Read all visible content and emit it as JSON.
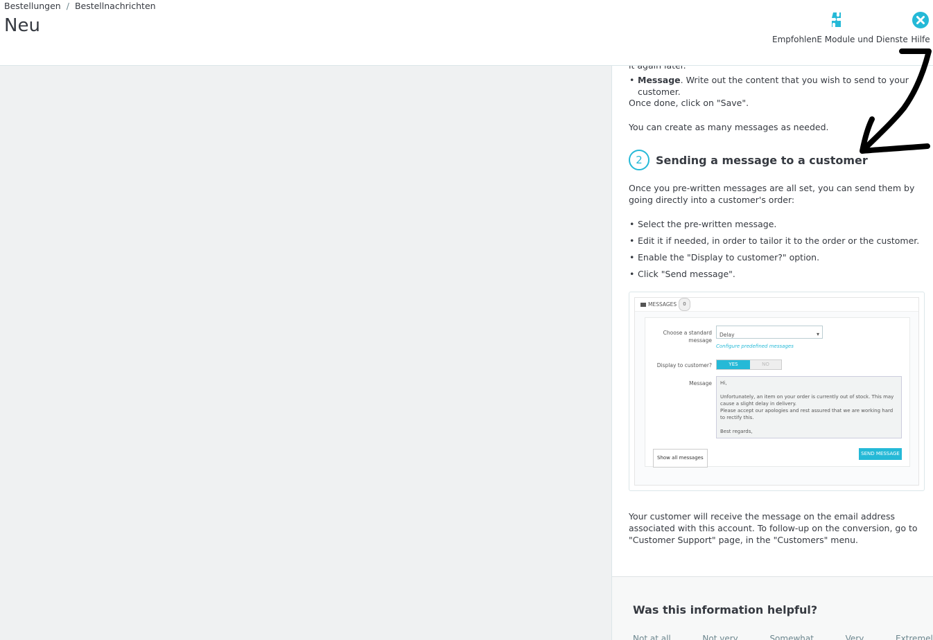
{
  "breadcrumb": {
    "items": [
      "Bestellungen",
      "Bestellnachrichten"
    ],
    "separator": "/"
  },
  "page": {
    "title": "Neu"
  },
  "toolbar": {
    "modules_label": "EmpfohlenE Module und Dienste",
    "modules_icon": "puzzle-icon",
    "help_label": "Hilfe",
    "help_icon": "close-circle-icon"
  },
  "help": {
    "cut_text": "it again later.",
    "list1": [
      {
        "bold": "Message",
        "text": ". Write out the content that you wish to send to your customer."
      }
    ],
    "save_text": "Once done, click on \"Save\".",
    "many_text": "You can create as many messages as needed.",
    "step_number": "2",
    "step_title": "Sending a message to a customer",
    "intro": "Once you pre-written messages are all set, you can send them by going directly into a customer's order:",
    "list2": [
      "Select the pre-written message.",
      "Edit it if needed, in order to tailor it to the order or the customer.",
      "Enable the \"Display to customer?\" option.",
      "Click \"Send message\"."
    ],
    "final": "Your customer will receive the message on the email address associated with this account. To follow-up on the conversion, go to \"Customer Support\" page, in the \"Customers\" menu.",
    "feedback_title": "Was this information helpful?",
    "feedback_options": [
      "Not at all",
      "Not very",
      "Somewhat",
      "Very",
      "Extremely"
    ]
  },
  "screenshot": {
    "header": "MESSAGES",
    "badge": "0",
    "choose_label": "Choose a standard message",
    "select_value": "Delay",
    "config_link": "Configure predefined messages",
    "display_label": "Display to customer?",
    "yes": "YES",
    "no": "NO",
    "message_label": "Message",
    "message_lines": [
      "Hi,",
      "",
      "Unfortunately, an item on your order is currently out of stock. This may cause a slight delay in delivery.",
      "Please accept our apologies and rest assured that we are working hard to rectify this.",
      "",
      "Best regards,"
    ],
    "show_all": "Show all messages",
    "send": "SEND MESSAGE"
  },
  "colors": {
    "accent": "#25b9d7",
    "text": "#363a41",
    "background": "#eff1f2"
  }
}
